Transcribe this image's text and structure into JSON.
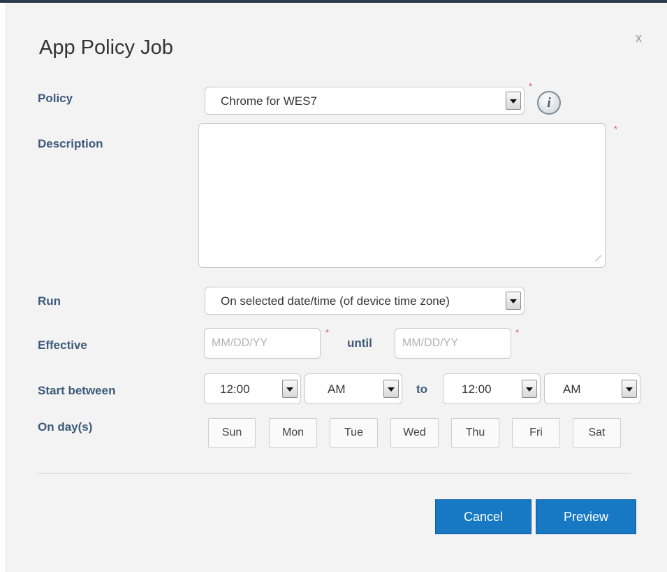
{
  "dialog": {
    "title": "App Policy Job",
    "close_label": "x"
  },
  "form": {
    "required_mark": "*",
    "policy": {
      "label": "Policy",
      "value": "Chrome for WES7"
    },
    "description": {
      "label": "Description",
      "value": ""
    },
    "run": {
      "label": "Run",
      "value": "On selected date/time (of device time zone)"
    },
    "effective": {
      "label": "Effective",
      "from_placeholder": "MM/DD/YY",
      "until_label": "until",
      "until_placeholder": "MM/DD/YY"
    },
    "start_between": {
      "label": "Start between",
      "from_time": "12:00",
      "from_ampm": "AM",
      "to_label": "to",
      "to_time": "12:00",
      "to_ampm": "AM"
    },
    "days": {
      "label": "On day(s)",
      "items": [
        "Sun",
        "Mon",
        "Tue",
        "Wed",
        "Thu",
        "Fri",
        "Sat"
      ]
    }
  },
  "footer": {
    "cancel_label": "Cancel",
    "preview_label": "Preview"
  },
  "colors": {
    "label": "#3d5a7a",
    "button": "#1779c3",
    "required": "#d9534f"
  },
  "icons": {
    "info": "info-circle-icon",
    "dropdown": "chevron-down-icon",
    "close": "close-icon"
  }
}
